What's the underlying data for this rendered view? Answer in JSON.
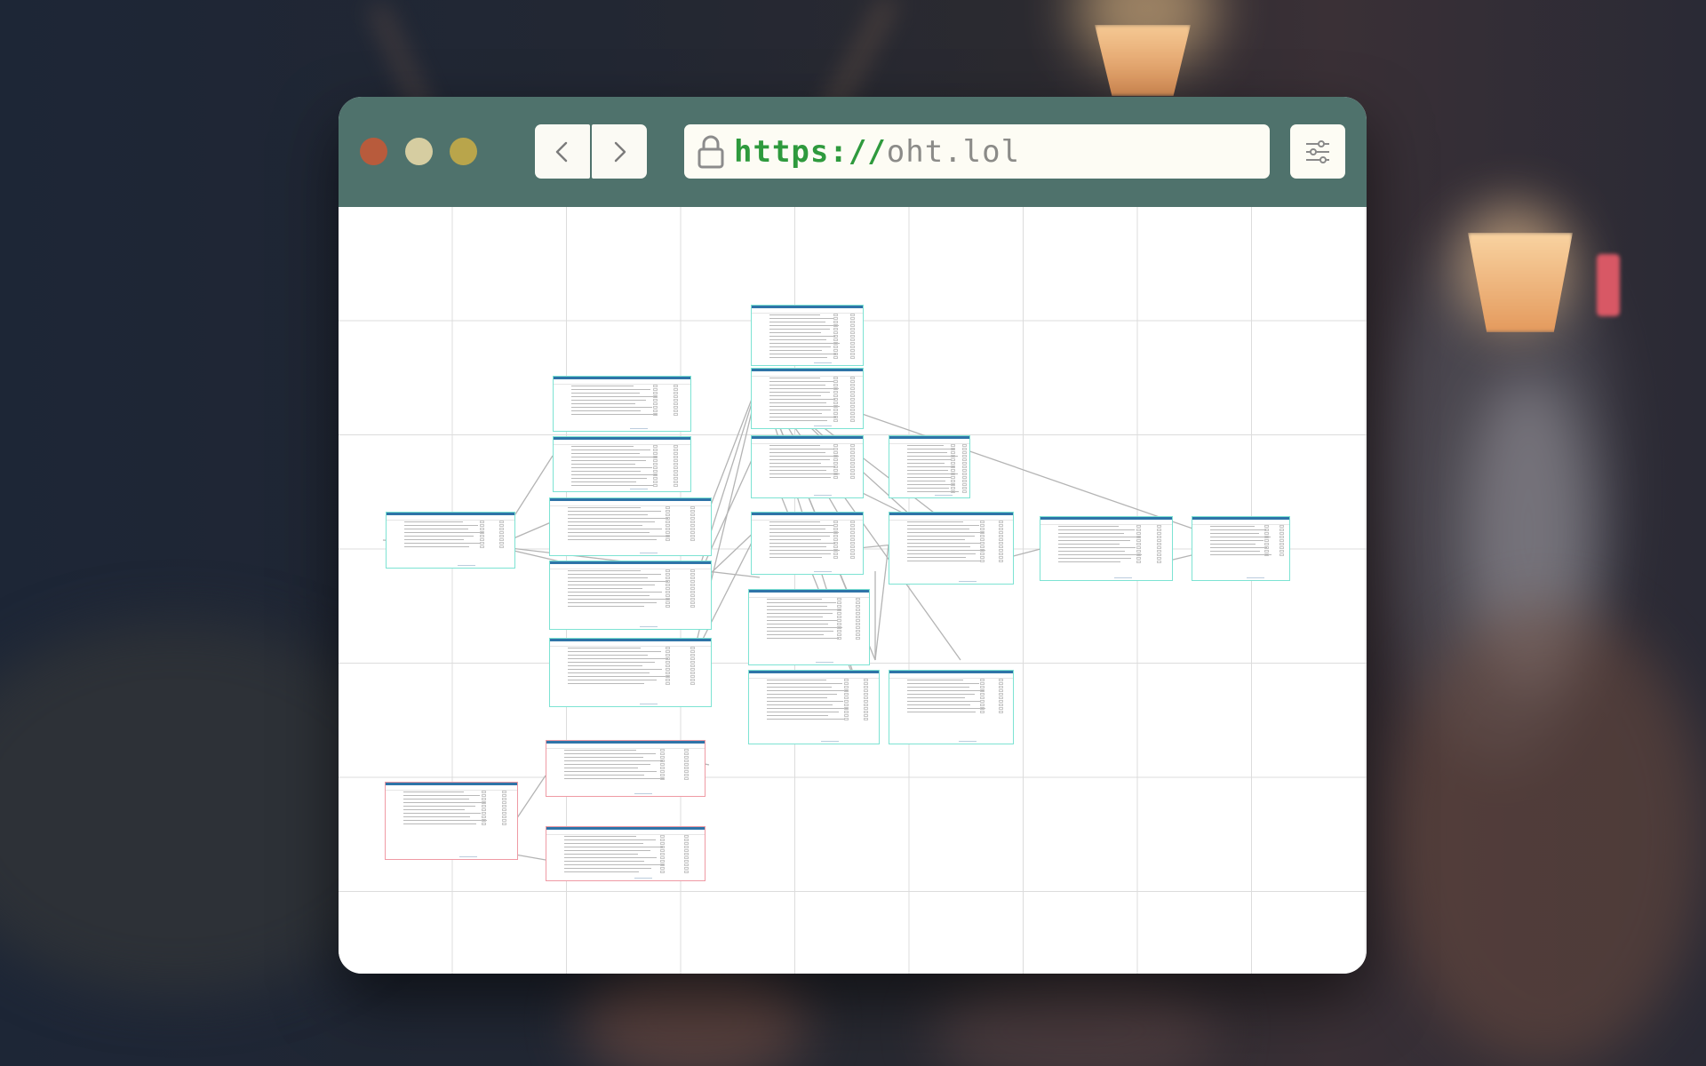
{
  "browser": {
    "url_scheme": "https://",
    "url_host": "oht.lol",
    "icons": {
      "back": "chevron-left-icon",
      "forward": "chevron-right-icon",
      "lock": "lock-icon",
      "menu": "sliders-menu-icon"
    },
    "colors": {
      "titlebar": "#4f726c",
      "close": "#b85b3c",
      "minimize": "#d6cda1",
      "maximize": "#b9a54b",
      "scheme": "#2e9a3d",
      "host": "#8b8b88"
    }
  },
  "diagram": {
    "tables": [
      {
        "id": "t01",
        "rows": 8,
        "accent": "teal"
      },
      {
        "id": "t02",
        "rows": 9,
        "accent": "teal"
      },
      {
        "id": "t03",
        "rows": 12,
        "accent": "teal"
      },
      {
        "id": "t04",
        "rows": 10,
        "accent": "teal"
      },
      {
        "id": "t05",
        "rows": 11,
        "accent": "teal"
      },
      {
        "id": "t06",
        "rows": 11,
        "accent": "teal"
      },
      {
        "id": "t07",
        "rows": 14,
        "accent": "teal"
      },
      {
        "id": "t08",
        "rows": 14,
        "accent": "teal"
      },
      {
        "id": "t09",
        "rows": 10,
        "accent": "teal"
      },
      {
        "id": "t10",
        "rows": 11,
        "accent": "teal"
      },
      {
        "id": "t11",
        "rows": 12,
        "accent": "teal"
      },
      {
        "id": "t12",
        "rows": 12,
        "accent": "teal"
      },
      {
        "id": "t13",
        "rows": 15,
        "accent": "teal"
      },
      {
        "id": "t14",
        "rows": 12,
        "accent": "teal"
      },
      {
        "id": "t15",
        "rows": 10,
        "accent": "teal"
      },
      {
        "id": "t16",
        "rows": 11,
        "accent": "teal"
      },
      {
        "id": "t17",
        "rows": 9,
        "accent": "pink"
      },
      {
        "id": "t18",
        "rows": 10,
        "accent": "pink"
      },
      {
        "id": "t19",
        "rows": 11,
        "accent": "pink"
      }
    ]
  }
}
